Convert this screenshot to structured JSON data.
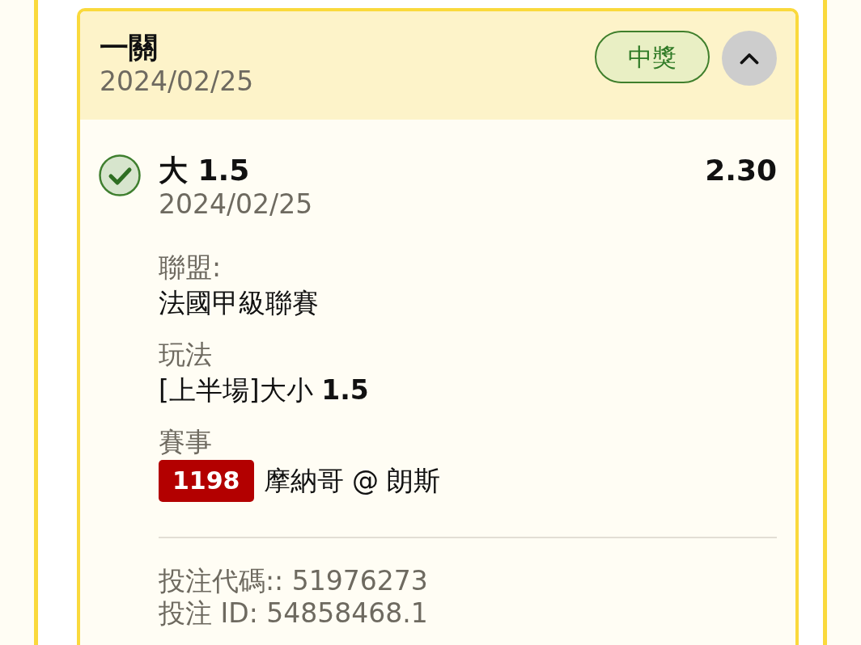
{
  "bet": {
    "title": "一關",
    "date": "2024/02/25",
    "status": {
      "kind": "won",
      "label": "中獎"
    },
    "expanded": true
  },
  "selections": [
    {
      "won": true,
      "title": "大 1.5",
      "odds": "2.30",
      "date": "2024/02/25",
      "details": [
        {
          "kind": "text",
          "label": "聯盟:",
          "value": "法國甲級聯賽"
        },
        {
          "kind": "text",
          "label": "玩法",
          "value": "[上半場]大小 **1.5**"
        },
        {
          "kind": "match",
          "label": "賽事",
          "match_number": "1198",
          "value": "摩納哥 @ 朗斯"
        }
      ]
    }
  ],
  "references": [
    "投注代碼:: 51976273",
    "投注 ID: 54858468.1"
  ]
}
